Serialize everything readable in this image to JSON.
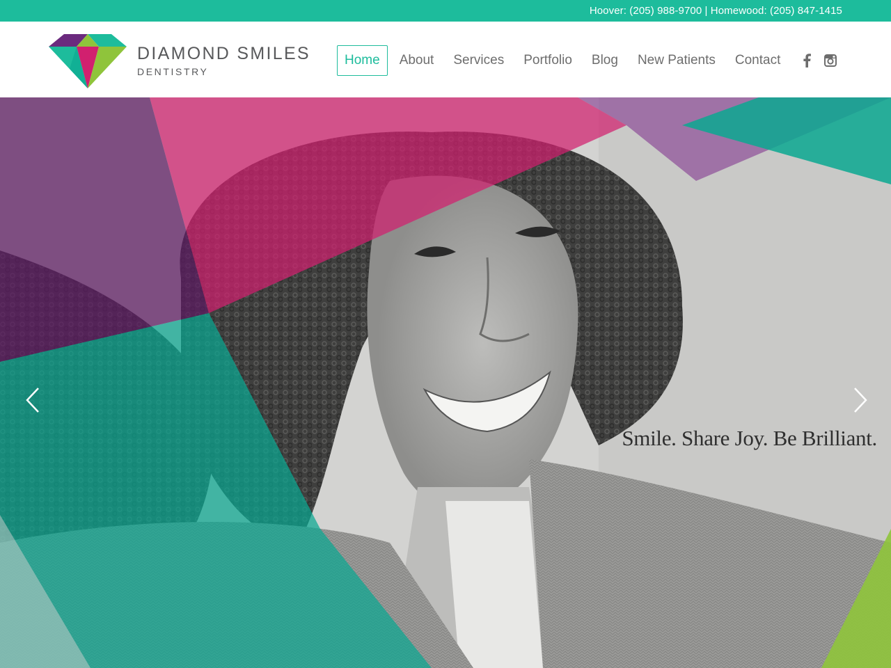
{
  "topbar": {
    "phones": "Hoover: (205) 988-9700 | Homewood: (205) 847-1415"
  },
  "logo": {
    "brand": "DIAMOND SMILES",
    "sub": "DENTISTRY"
  },
  "nav": {
    "items": [
      "Home",
      "About",
      "Services",
      "Portfolio",
      "Blog",
      "New Patients",
      "Contact"
    ],
    "active": "Home",
    "social_icons": [
      "facebook-icon",
      "instagram-icon"
    ]
  },
  "hero": {
    "tagline": "Smile. Share Joy. Be Brilliant.",
    "prev_icon": "chevron-left-icon",
    "next_icon": "chevron-right-icon"
  },
  "colors": {
    "accent": "#1dbc9c",
    "magenta": "#d1206f",
    "purple": "#6b2a7e",
    "teal": "#0aa891",
    "lime": "#8fc43b",
    "nav_text": "#6d6d6d"
  }
}
